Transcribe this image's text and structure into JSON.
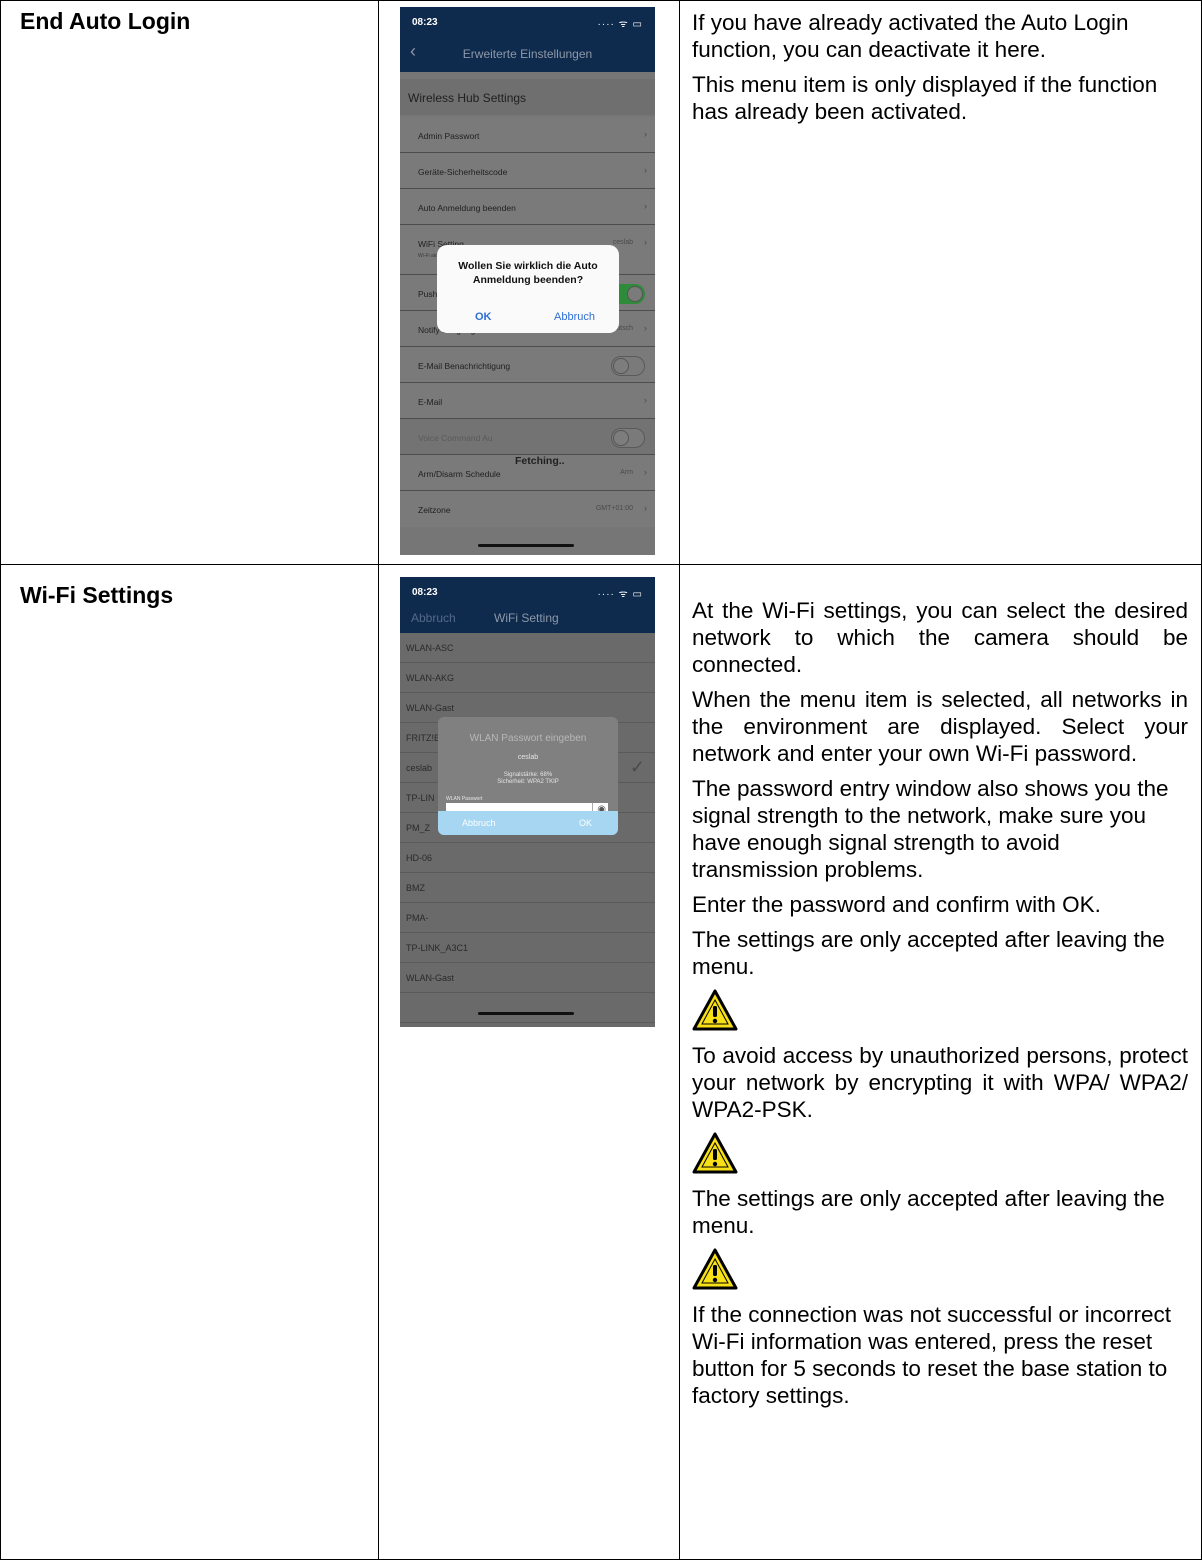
{
  "rows": [
    {
      "title": "End Auto Login",
      "paragraphs": [
        "If you have already activated the Auto Login function, you can deactivate it here.",
        "This menu item is only displayed if the function has already been activated."
      ],
      "phone": {
        "time": "08:23",
        "status_icons": "… ▾ ▮",
        "nav_title": "Erweiterte Einstellungen",
        "section_header": "Wireless Hub Settings",
        "items": [
          {
            "label": "Admin Passwort",
            "value": ""
          },
          {
            "label": "Geräte-Sicherheitscode",
            "value": ""
          },
          {
            "label": "Auto Anmeldung beenden",
            "value": ""
          },
          {
            "label": "WiFi Setting",
            "value": "ceslab",
            "sub": "Wi-Fi aktiv über ..."
          },
          {
            "label": "Push",
            "toggle": "on"
          },
          {
            "label": "Notify Language",
            "value": "Deutsch"
          },
          {
            "label": "E-Mail Benachrichtigung",
            "toggle": "off"
          },
          {
            "label": "E-Mail",
            "value": ""
          },
          {
            "label": "Voice Command Au",
            "toggle": "off"
          },
          {
            "label": "Arm/Disarm Schedule",
            "value": "Arm"
          },
          {
            "label": "Zeitzone",
            "value": "GMT+01:00"
          }
        ],
        "alert": {
          "message_line1": "Wollen Sie wirklich die Auto",
          "message_line2": "Anmeldung beenden?",
          "ok": "OK",
          "cancel": "Abbruch"
        },
        "fetching": "Fetching.."
      }
    },
    {
      "title": "Wi-Fi Settings",
      "paragraphs": [
        "At the Wi-Fi settings, you can select the desired network to which the camera should be connected.",
        "When the menu item is selected, all networks in the environment are displayed. Select your network and enter your own Wi-Fi password.",
        "The password entry window also shows you the signal strength to the network, make sure you have enough signal strength to avoid transmission problems.",
        "Enter the password and confirm with OK.",
        "The settings are only accepted after leaving the menu.",
        "To avoid access by unauthorized persons, protect your network by encrypting it with WPA/ WPA2/ WPA2-PSK.",
        "The settings are only accepted after leaving the menu.",
        "If the connection was not successful or incorrect Wi-Fi information was entered, press the reset button for 5 seconds to reset the base station to factory settings."
      ],
      "phone": {
        "time": "08:23",
        "status_icons": "… ▾ ▮",
        "nav_left": "Abbruch",
        "nav_title": "WiFi Setting",
        "networks": [
          "WLAN-ASC",
          "WLAN-AKG",
          "WLAN-Gast",
          "FRITZ!Box",
          "ceslab",
          "TP-LIN",
          "PM_Z",
          "HD-06",
          "BMZ",
          "PMA-",
          "TP-LINK_A3C1",
          "WLAN-Gast"
        ],
        "dialog": {
          "title": "WLAN Passwort eingeben",
          "ssid": "ceslab",
          "signal": "Signalstärke: 68%",
          "security": "Sicherheit: WPA2 TKIP",
          "field_label": "WLAN Passwort",
          "cancel": "Abbruch",
          "ok": "OK"
        }
      }
    }
  ],
  "colors": {
    "nav": "#0e2a4c",
    "toggle_on": "#2e8b3a",
    "dialog_bar": "#a6d6f2",
    "warning_yellow": "#f7e017"
  },
  "icons": [
    "warning-icon",
    "chevron-right-icon",
    "back-chevron-icon",
    "checkmark-icon",
    "eye-slash-icon",
    "wifi-icon",
    "battery-icon"
  ]
}
